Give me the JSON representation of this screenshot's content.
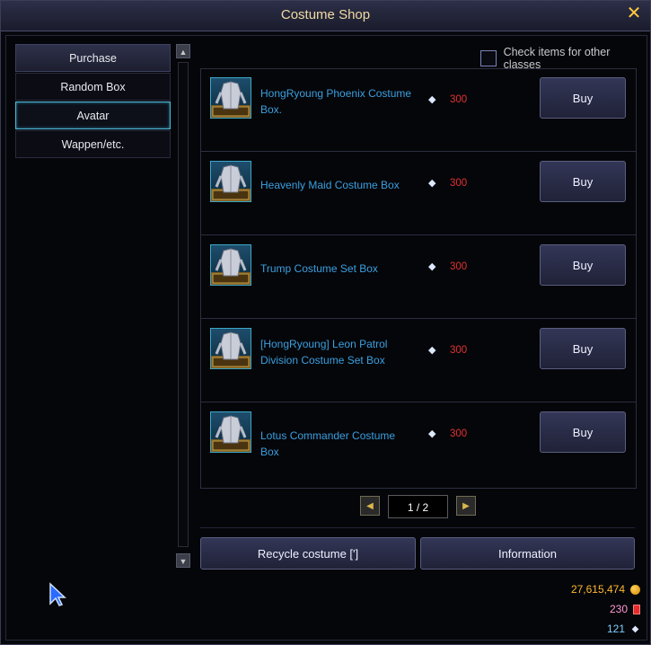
{
  "window": {
    "title": "Costume Shop"
  },
  "categories": [
    {
      "label": "Purchase"
    },
    {
      "label": "Random Box"
    },
    {
      "label": "Avatar"
    },
    {
      "label": "Wappen/etc."
    }
  ],
  "filter": {
    "label": "Check items for other classes",
    "checked": false
  },
  "items": [
    {
      "name": "HongRyoung Phoenix Costume Box.",
      "price": "300",
      "buy_label": "Buy"
    },
    {
      "name": "Heavenly Maid Costume Box",
      "price": "300",
      "buy_label": "Buy"
    },
    {
      "name": "Trump Costume Set Box",
      "price": "300",
      "buy_label": "Buy"
    },
    {
      "name": "[HongRyoung] Leon Patrol Division Costume Set Box",
      "price": "300",
      "buy_label": "Buy"
    },
    {
      "name": "Lotus Commander Costume Box",
      "price": "300",
      "buy_label": "Buy"
    }
  ],
  "pagination": {
    "label": "1 / 2"
  },
  "actions": {
    "recycle_label": "Recycle costume [']",
    "info_label": "Information"
  },
  "currency": {
    "gold": "27,615,474",
    "tickets": "230",
    "gems": "121"
  },
  "colors": {
    "accent_gold": "#ffc940",
    "item_name": "#3a9fe0",
    "price": "#e03232"
  }
}
